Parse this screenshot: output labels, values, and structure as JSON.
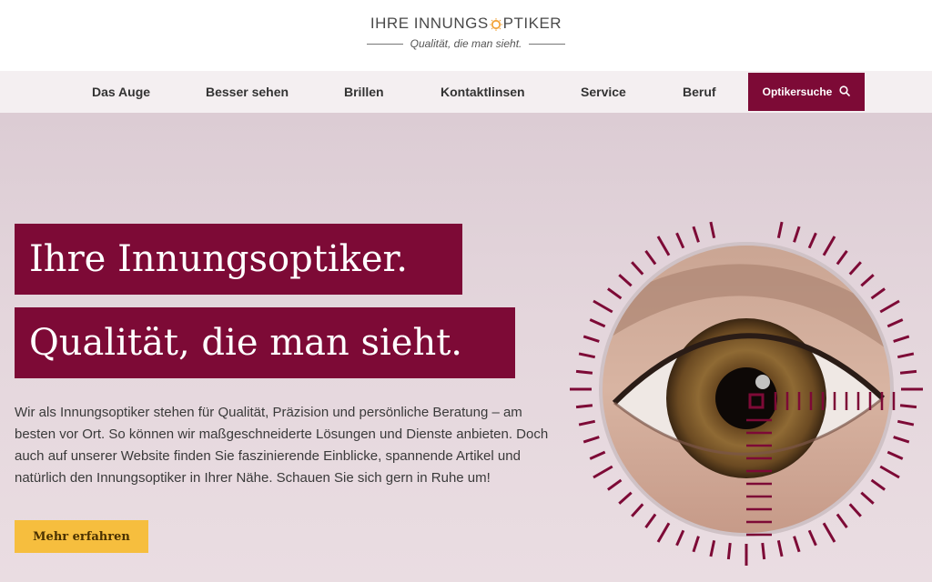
{
  "logo": {
    "name_part1": "IHRE INNUNGS",
    "name_part2": "PTIKER",
    "tagline": "Qualität, die man sieht."
  },
  "nav": {
    "items": [
      {
        "label": "Das Auge"
      },
      {
        "label": "Besser sehen"
      },
      {
        "label": "Brillen"
      },
      {
        "label": "Kontaktlinsen"
      },
      {
        "label": "Service"
      },
      {
        "label": "Beruf"
      }
    ],
    "search_label": "Optikersuche",
    "search_icon": "search-icon"
  },
  "hero": {
    "headline_1": "Ihre Innungsoptiker.",
    "headline_2": "Qualität, die man sieht.",
    "intro": "Wir als Innungsoptiker stehen für Qualität, Präzision und persönliche Beratung – am besten vor Ort. So können wir maßgeschneiderte Lösungen und Dienste anbieten. Doch auch auf unserer Website finden Sie faszinierende Einblicke, spannende Artikel und natürlich den Innungsoptiker in Ihrer Nähe. Schauen Sie sich gern in Ruhe um!",
    "cta_label": "Mehr erfahren"
  },
  "colors": {
    "brand": "#7d0a36",
    "cta": "#f6be3e",
    "nav_bg": "#f4eff1",
    "hero_bg": "#e4d6dc"
  }
}
